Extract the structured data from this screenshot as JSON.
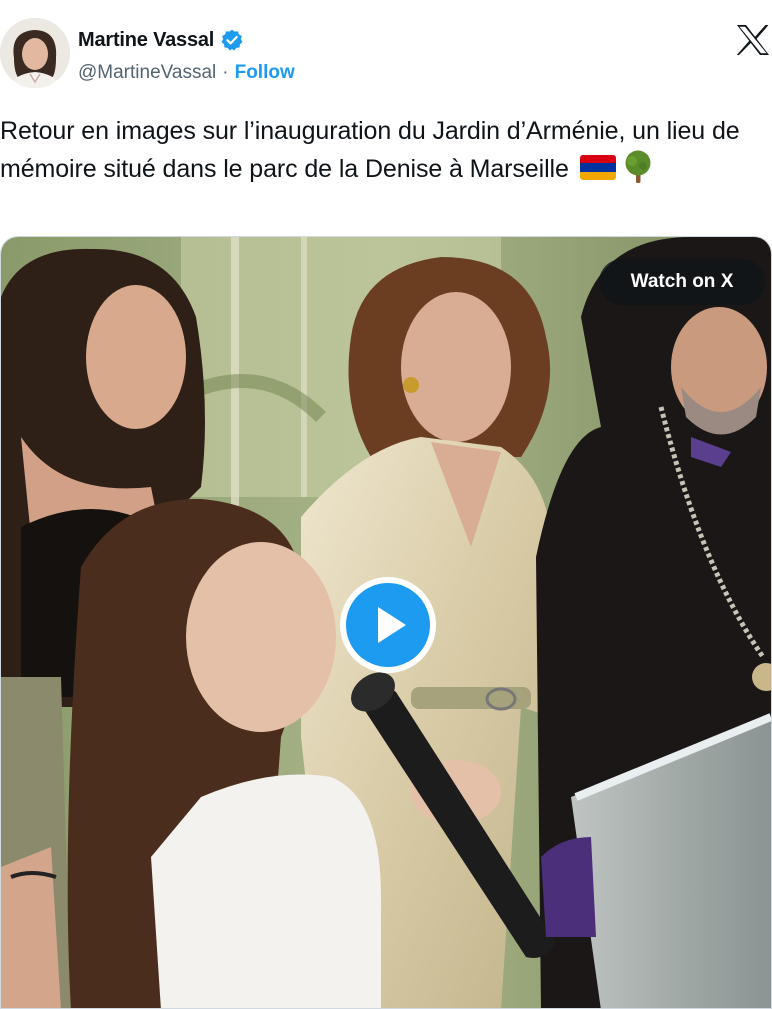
{
  "author": {
    "name": "Martine Vassal",
    "handle": "@MartineVassal",
    "separator": "·",
    "follow_label": "Follow",
    "verified_color": "#1d9bf0"
  },
  "platform_icon": "x-logo-icon",
  "tweet": {
    "text": "Retour en images sur l’inauguration du Jardin d’Arménie, un lieu de mémoire situé dans le parc de la Denise à Marseille",
    "emojis": [
      "armenia-flag",
      "deciduous-tree"
    ]
  },
  "media": {
    "type": "video",
    "watch_label": "Watch on X",
    "play_icon": "play-icon"
  },
  "colors": {
    "accent": "#1d9bf0",
    "text": "#0f1419",
    "secondary": "#536471",
    "flag_red": "#d90012",
    "flag_blue": "#0033a0",
    "flag_orange": "#f2a800"
  }
}
